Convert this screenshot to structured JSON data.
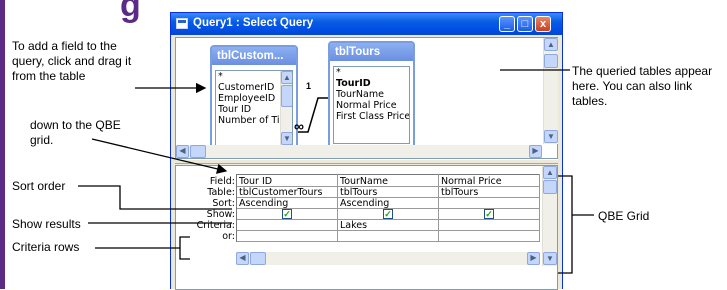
{
  "slide": {
    "partial_title": "g",
    "callouts": {
      "add_field": "To add a field to the query, click and drag it from the table",
      "down_qbe": "down to the QBE grid.",
      "sort_order": "Sort order",
      "show_results": "Show results",
      "criteria_rows": "Criteria rows",
      "queried_tables": "The queried tables appear here. You can also link tables.",
      "qbe_grid": "QBE Grid"
    }
  },
  "window": {
    "title": "Query1 : Select Query",
    "controls": {
      "minimize": "_",
      "maximize": "□",
      "close": "x"
    }
  },
  "tables": [
    {
      "name": "tblCustom...",
      "fields": [
        "*",
        "CustomerID",
        "EmployeeID",
        "Tour ID",
        "Number of Tic"
      ],
      "bold_fields": []
    },
    {
      "name": "tblTours",
      "fields": [
        "*",
        "TourID",
        "TourName",
        "Normal Price",
        "First Class Price"
      ],
      "bold_fields": [
        "TourID"
      ]
    }
  ],
  "relationship": {
    "one": "1",
    "many": "∞"
  },
  "grid": {
    "row_labels": [
      "Field:",
      "Table:",
      "Sort:",
      "Show:",
      "Criteria:",
      "or:"
    ],
    "columns": [
      {
        "field": "Tour ID",
        "table": "tblCustomerTours",
        "sort": "Ascending",
        "show": true,
        "criteria": "",
        "or": ""
      },
      {
        "field": "TourName",
        "table": "tblTours",
        "sort": "Ascending",
        "show": true,
        "criteria": "Lakes",
        "or": ""
      },
      {
        "field": "Normal Price",
        "table": "tblTours",
        "sort": "",
        "show": true,
        "criteria": "",
        "or": ""
      }
    ]
  },
  "colors": {
    "slide_accent": "#5b2a86",
    "titlebar": "#0050e6",
    "check": "#21a121"
  }
}
